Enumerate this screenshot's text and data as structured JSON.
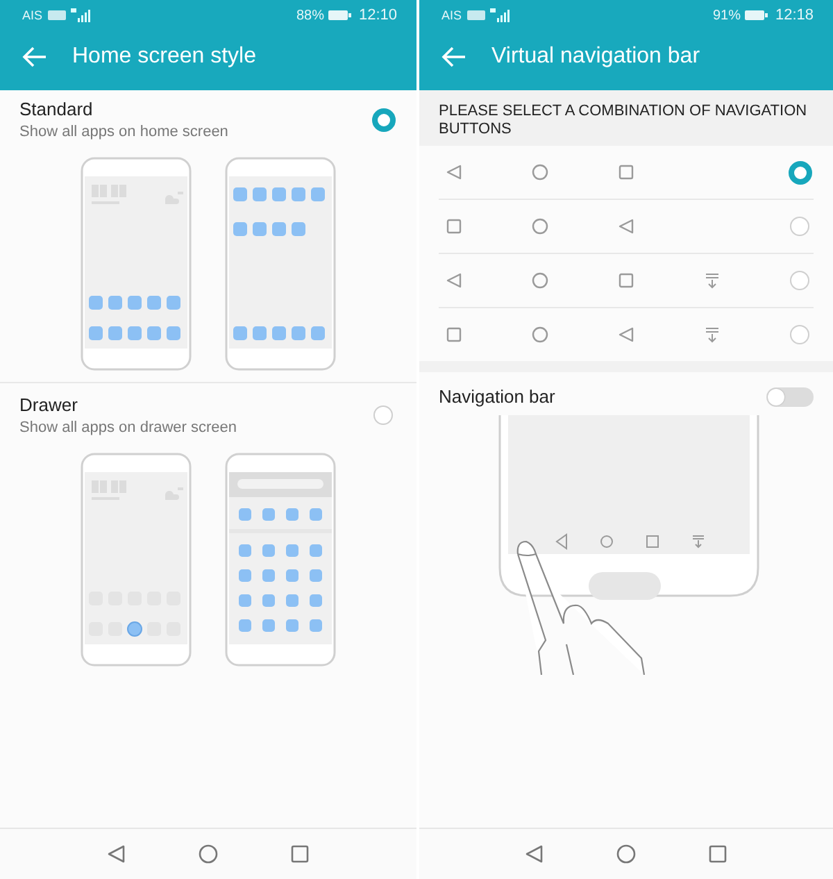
{
  "screens": [
    {
      "kind": "home_style",
      "status_bar": {
        "carrier": "AIS",
        "battery": "88%",
        "time": "12:10"
      },
      "title": "Home screen style",
      "options": [
        {
          "kind": "standard",
          "title": "Standard",
          "subtitle": "Show all apps on home screen",
          "selected": true
        },
        {
          "kind": "drawer",
          "title": "Drawer",
          "subtitle": "Show all apps on drawer screen",
          "selected": false
        }
      ]
    },
    {
      "kind": "navigation",
      "status_bar": {
        "carrier": "AIS",
        "battery": "91%",
        "time": "12:18"
      },
      "title": "Virtual navigation bar",
      "section_header": "PLEASE SELECT A COMBINATION OF NAVIGATION BUTTONS",
      "combinations": [
        {
          "buttons": [
            {
              "kind": "back"
            },
            {
              "kind": "home"
            },
            {
              "kind": "recent"
            }
          ],
          "selected": true
        },
        {
          "buttons": [
            {
              "kind": "recent"
            },
            {
              "kind": "home"
            },
            {
              "kind": "back"
            }
          ],
          "selected": false
        },
        {
          "buttons": [
            {
              "kind": "back"
            },
            {
              "kind": "home"
            },
            {
              "kind": "recent"
            },
            {
              "kind": "notifications"
            }
          ],
          "selected": false
        },
        {
          "buttons": [
            {
              "kind": "recent"
            },
            {
              "kind": "home"
            },
            {
              "kind": "back"
            },
            {
              "kind": "notifications"
            }
          ],
          "selected": false
        }
      ],
      "toggle": {
        "label": "Navigation bar",
        "on": false
      }
    }
  ]
}
